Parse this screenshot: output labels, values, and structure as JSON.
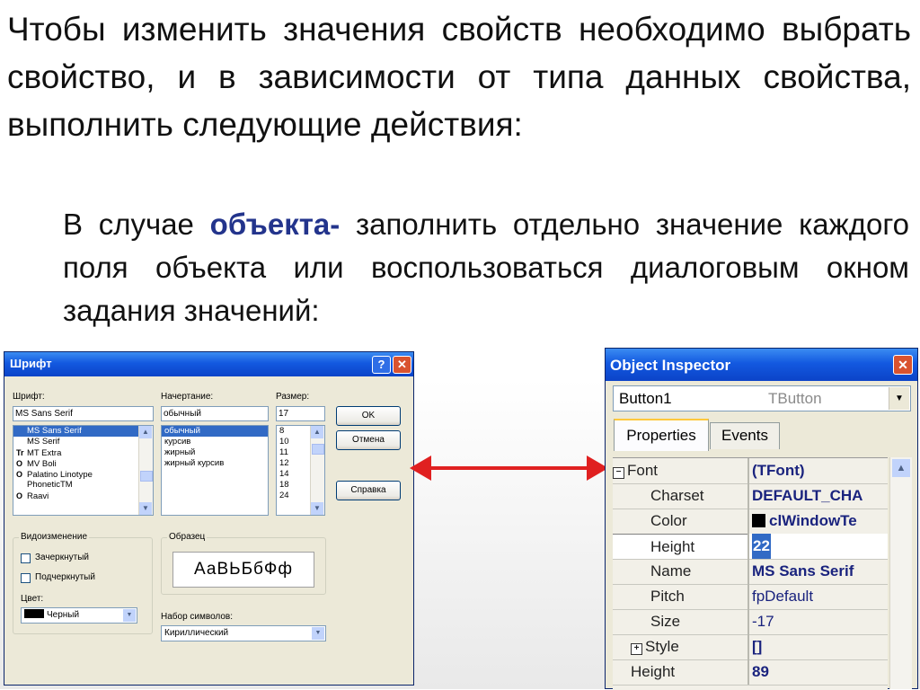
{
  "intro": "Чтобы изменить значения свойств необходимо выбрать свойство, и в зависимости от типа данных свойства, выполнить следующие действия:",
  "sub": {
    "prefix": "В случае ",
    "emph": "объекта-",
    "rest": " заполнить отдельно значение каждого поля объекта или воспользоваться диалоговым окном задания значений:"
  },
  "font_dialog": {
    "title": "Шрифт",
    "help_glyph": "?",
    "close_glyph": "✕",
    "font_label": "Шрифт:",
    "font_value": "MS Sans Serif",
    "fonts": [
      {
        "icon": "",
        "name": "MS Sans Serif",
        "selected": true
      },
      {
        "icon": "",
        "name": "MS Serif"
      },
      {
        "icon": "Tr",
        "name": "MT Extra"
      },
      {
        "icon": "O",
        "name": "MV Boli"
      },
      {
        "icon": "O",
        "name": "Palatino Linotype"
      },
      {
        "icon": "",
        "name": "PhoneticTM"
      },
      {
        "icon": "O",
        "name": "Raavi"
      }
    ],
    "style_label": "Начертание:",
    "style_value": "обычный",
    "styles": [
      "обычный",
      "курсив",
      "жирный",
      "жирный курсив"
    ],
    "size_label": "Размер:",
    "size_value": "17",
    "sizes": [
      "8",
      "10",
      "11",
      "12",
      "14",
      "18",
      "24"
    ],
    "ok_label": "OK",
    "cancel_label": "Отмена",
    "help_label": "Справка",
    "effects_label": "Видоизменение",
    "strikeout_label": "Зачеркнутый",
    "underline_label": "Подчеркнутый",
    "color_label": "Цвет:",
    "color_value": "Черный",
    "sample_label": "Образец",
    "sample_text": "АаВЬБбФф",
    "charset_label": "Набор символов:",
    "charset_value": "Кириллический"
  },
  "object_inspector": {
    "title": "Object Inspector",
    "close_glyph": "✕",
    "component_name": "Button1",
    "component_type": "TButton",
    "tab_properties": "Properties",
    "tab_events": "Events",
    "rows": [
      {
        "name": "Font",
        "value": "(TFont)",
        "expand": "−"
      },
      {
        "name": "Charset",
        "value": "DEFAULT_CHA"
      },
      {
        "name": "Color",
        "value": "clWindowTe"
      },
      {
        "name": "Height",
        "value": "22"
      },
      {
        "name": "Name",
        "value": "MS Sans Serif"
      },
      {
        "name": "Pitch",
        "value": "fpDefault"
      },
      {
        "name": "Size",
        "value": "-17"
      },
      {
        "name": "Style",
        "value": "[]",
        "expand": "+"
      },
      {
        "name": "Height",
        "value": "89"
      }
    ]
  },
  "colors": {
    "titlebar": "#0b43c8",
    "emph": "#23348c",
    "arrow": "#e02020",
    "selection": "#316ac5"
  }
}
